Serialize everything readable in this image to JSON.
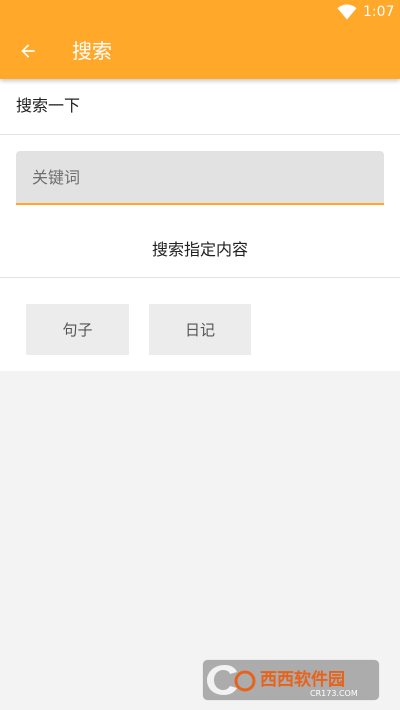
{
  "status_bar": {
    "time": "1:07",
    "wifi_icon": "wifi-full-icon"
  },
  "app_bar": {
    "back_icon": "arrow-back-icon",
    "title": "搜索"
  },
  "search": {
    "section_label": "搜索一下",
    "input_placeholder": "关键词",
    "input_value": ""
  },
  "filter": {
    "heading": "搜索指定内容",
    "options": [
      {
        "label": "句子"
      },
      {
        "label": "日记"
      }
    ]
  },
  "watermark": {
    "brand_text": "西西软件园",
    "url_text": "CR173.COM"
  },
  "colors": {
    "accent": "#ffa82a",
    "background": "#f3f3f3",
    "surface": "#ffffff",
    "chip_background": "#ececec",
    "input_background": "#e2e2e2",
    "watermark_orange": "#e8631a",
    "watermark_blue": "#1a6fd1"
  }
}
